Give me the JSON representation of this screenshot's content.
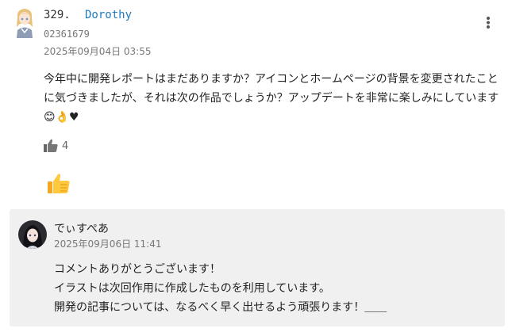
{
  "comment": {
    "number": "329.",
    "username": "Dorothy",
    "user_id": "02361679",
    "timestamp": "2025年09月04日 03:55",
    "body": "今年中に開発レポートはまだありますか？アイコンとホームページの背景を変更されたことに気づきましたが、それは次の作品でしょうか？アップデートを非常に楽しみにしています😊👌♥",
    "like_count": "4",
    "icons": {
      "avatar": "anime-girl-avatar",
      "more": "kebab-menu-icon",
      "like": "thumbs-up-icon",
      "reaction": "thumbs-up-emoji"
    }
  },
  "reply": {
    "name": "でぃすぺあ",
    "timestamp": "2025年09月06日 11:41",
    "lines": [
      "コメントありがとうございます！",
      "イラストは次回作用に作成したものを利用しています。",
      "開発の記事については、なるべく早く出せるよう頑張ります！＿＿"
    ],
    "background": "#f0f0f0"
  },
  "colors": {
    "link": "#1f7bbf",
    "meta": "#777777",
    "text": "#222222"
  }
}
